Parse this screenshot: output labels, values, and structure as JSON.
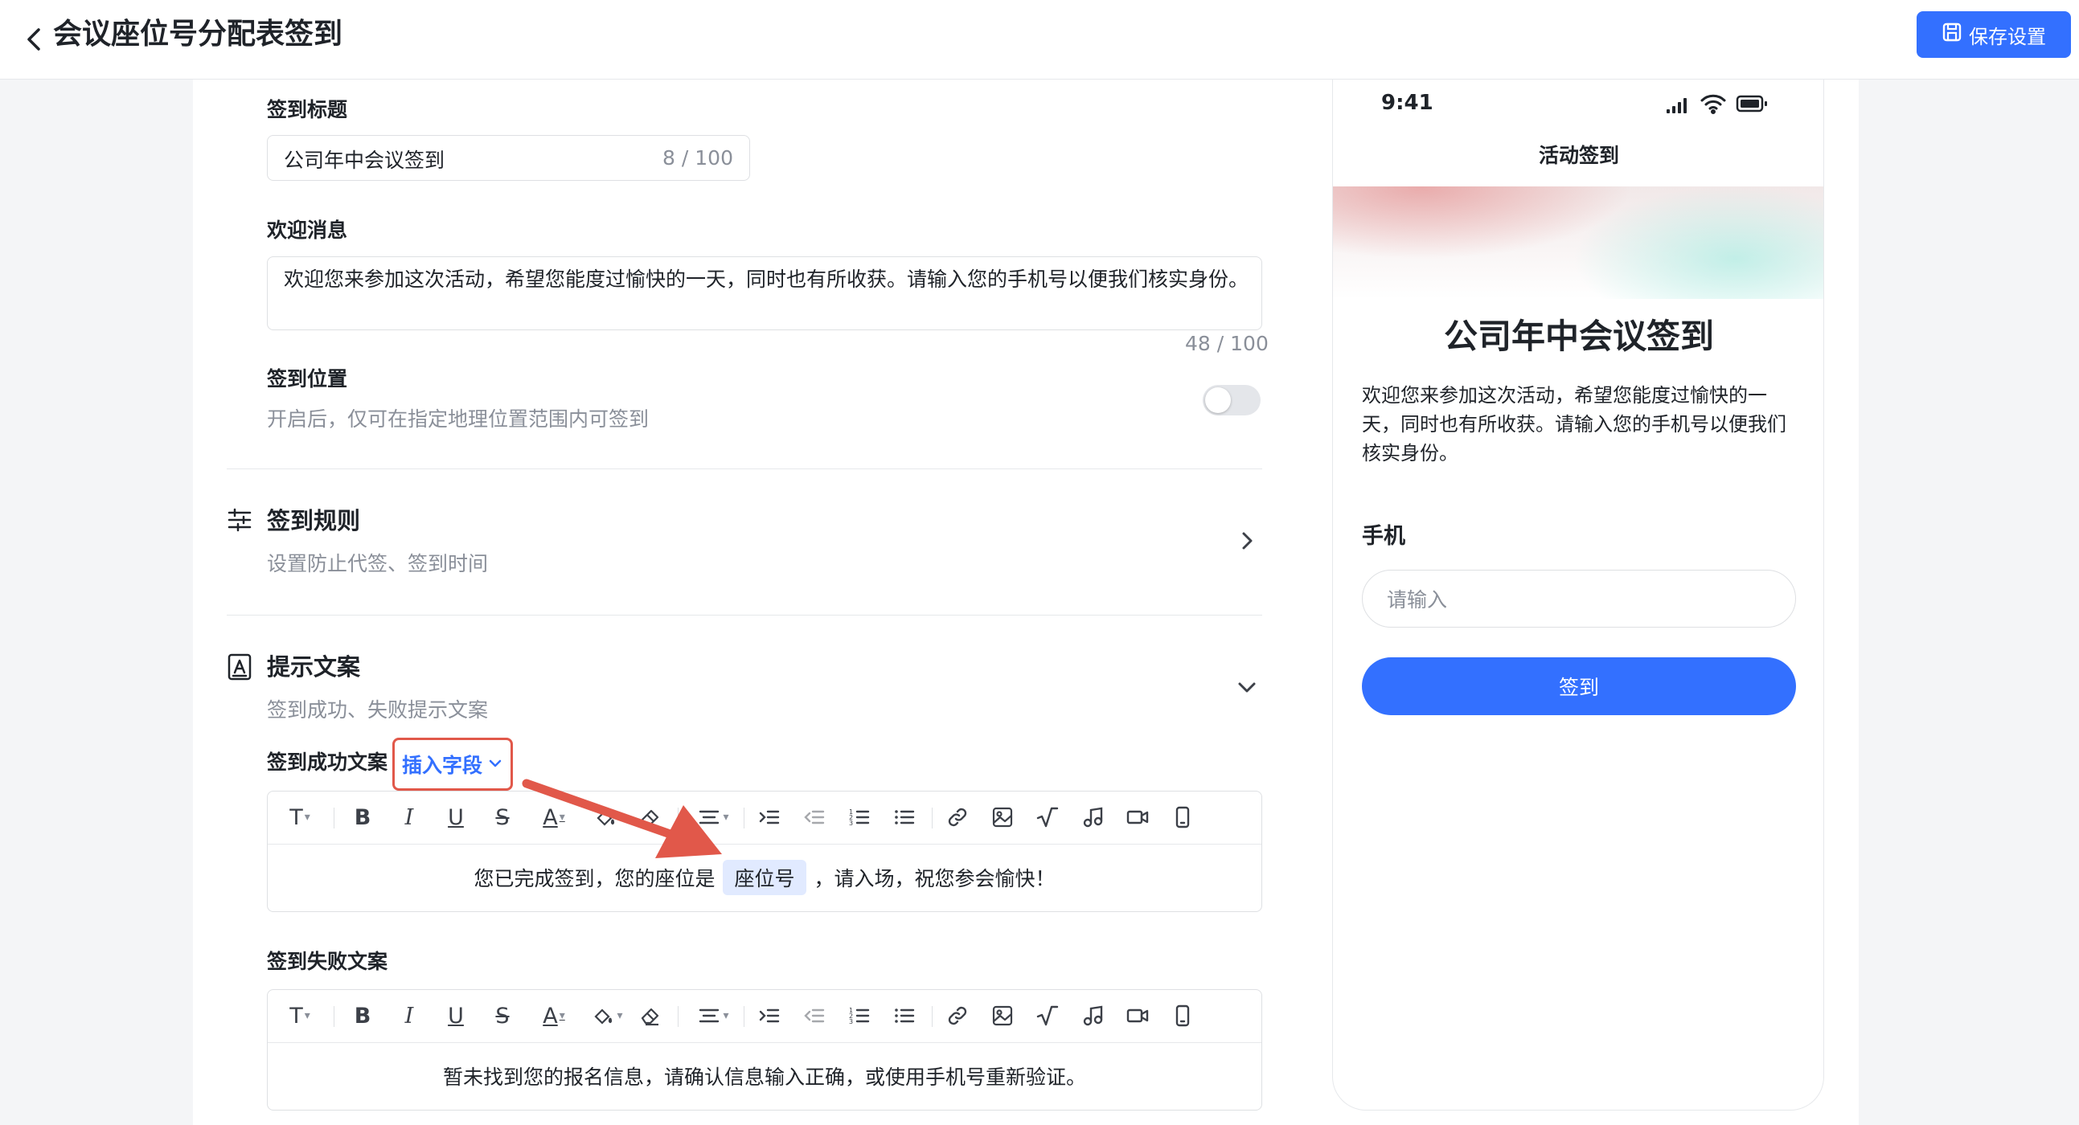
{
  "header": {
    "title": "会议座位号分配表签到",
    "save_label": "保存设置"
  },
  "settings": {
    "signin_title_label": "签到标题",
    "signin_title_value": "公司年中会议签到",
    "signin_title_counter": "8 / 100",
    "welcome_label": "欢迎消息",
    "welcome_value": "欢迎您来参加这次活动，希望您能度过愉快的一天，同时也有所收获。请输入您的手机号以便我们核实身份。",
    "welcome_counter": "48 / 100",
    "location_label": "签到位置",
    "location_desc": "开启后，仅可在指定地理位置范围内可签到",
    "location_enabled": false
  },
  "rules": {
    "title": "签到规则",
    "desc": "设置防止代签、签到时间"
  },
  "prompts": {
    "title": "提示文案",
    "desc": "签到成功、失败提示文案",
    "success_label": "签到成功文案",
    "insert_field_label": "插入字段",
    "success_before": "您已完成签到，您的座位是",
    "success_field": "座位号",
    "success_after": "，请入场，祝您参会愉快！",
    "fail_label": "签到失败文案",
    "fail_text": "暂未找到您的报名信息，请确认信息输入正确，或使用手机号重新验证。"
  },
  "toolbar_icons": [
    "text-style-icon",
    "bold-icon",
    "italic-icon",
    "underline-icon",
    "strikethrough-icon",
    "font-color-icon",
    "highlight-icon",
    "clear-format-icon",
    "align-icon",
    "indent-icon",
    "outdent-icon",
    "ordered-list-icon",
    "bullet-list-icon",
    "link-icon",
    "image-icon",
    "formula-icon",
    "audio-icon",
    "video-icon",
    "mobile-icon"
  ],
  "preview": {
    "time": "9:41",
    "nav_title": "活动签到",
    "title": "公司年中会议签到",
    "message": "欢迎您来参加这次活动，希望您能度过愉快的一天，同时也有所收获。请输入您的手机号以便我们核实身份。",
    "phone_label": "手机",
    "phone_placeholder": "请输入",
    "submit_label": "签到"
  },
  "colors": {
    "primary": "#3370ff",
    "annotation": "#e1584a",
    "chip_bg": "#e1eaff"
  }
}
